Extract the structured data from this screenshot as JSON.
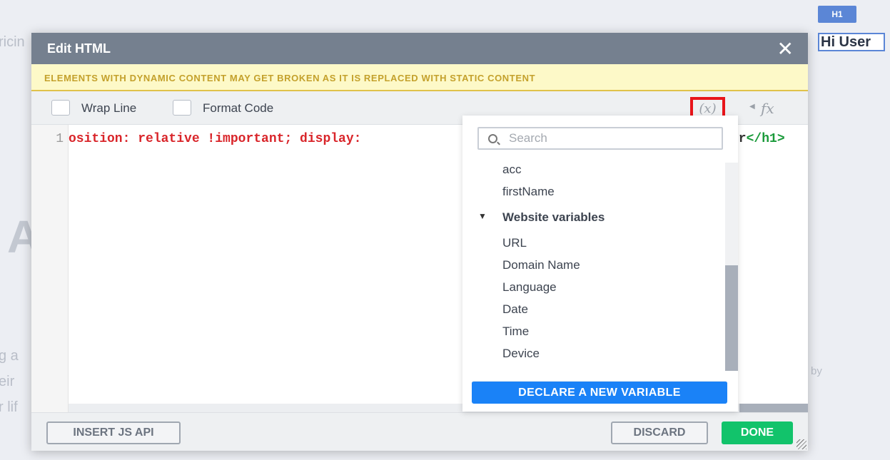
{
  "background": {
    "text_pricing": "ricin",
    "text_a": "A",
    "text_line1": "g a",
    "text_line2": "eir",
    "text_line3": "r lif",
    "text_by": "by",
    "h1_tag": "H1",
    "selected_heading": "Hi User"
  },
  "modal": {
    "title": "Edit HTML",
    "warning": "ELEMENTS WITH DYNAMIC CONTENT MAY GET BROKEN AS IT IS REPLACED WITH STATIC CONTENT",
    "toolbar": {
      "wrap_line": "Wrap Line",
      "format_code": "Format Code",
      "variables_icon": "(x)",
      "functions_icon": "fx"
    },
    "editor": {
      "line_number": "1",
      "code_visible": "osition: relative !important; display:",
      "code_tail_text": "er",
      "code_tail_tag": "</h1>",
      "colors": {
        "code": "#d9252a",
        "tag": "#1a9a3a"
      }
    },
    "footer": {
      "insert_js_api": "INSERT JS API",
      "discard": "DISCARD",
      "done": "DONE"
    }
  },
  "variables_dropdown": {
    "search_placeholder": "Search",
    "items": [
      "acc",
      "firstName"
    ],
    "group": {
      "label": "Website variables",
      "expanded": true,
      "items": [
        "URL",
        "Domain Name",
        "Language",
        "Date",
        "Time",
        "Device"
      ]
    },
    "declare_button": "DECLARE A NEW VARIABLE"
  }
}
